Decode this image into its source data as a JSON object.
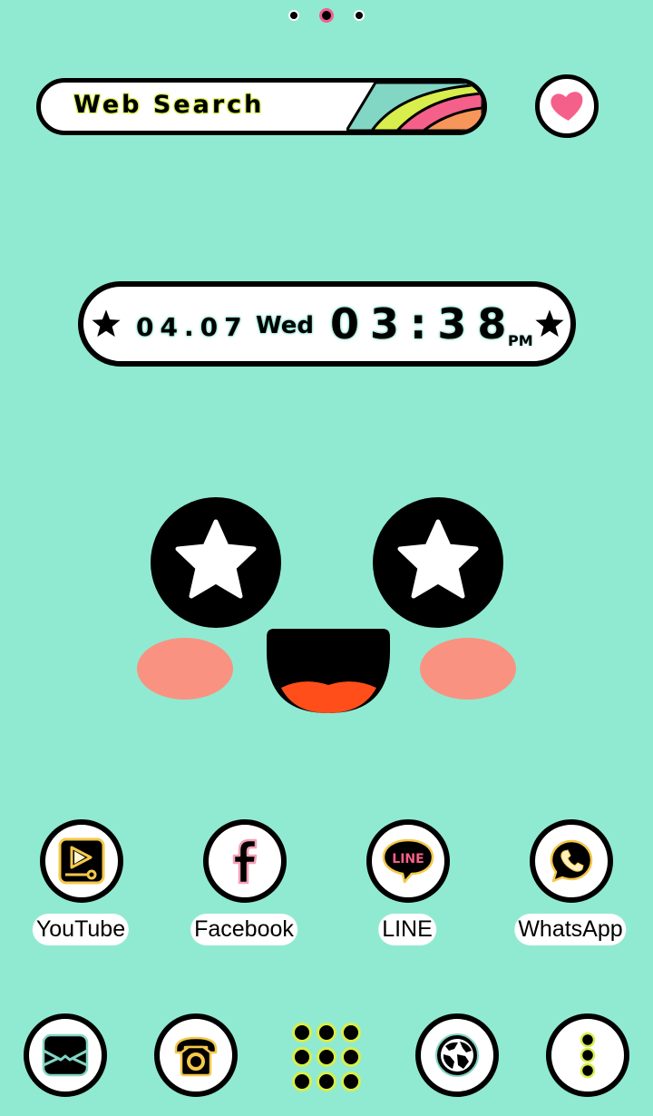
{
  "page_indicator": {
    "count": 3,
    "active_index": 1
  },
  "search_bar": {
    "label": "Web Search"
  },
  "favorites": {
    "icon": "heart-icon"
  },
  "clock": {
    "date": "04.07",
    "weekday": "Wed",
    "time": "03:38",
    "ampm": "PM"
  },
  "wallpaper": {
    "description": "kawaii face with star eyes, blush cheeks and open smile"
  },
  "apps": [
    {
      "label": "YouTube",
      "icon": "youtube-icon"
    },
    {
      "label": "Facebook",
      "icon": "facebook-icon"
    },
    {
      "label": "LINE",
      "icon": "line-icon",
      "icon_text": "LINE"
    },
    {
      "label": "WhatsApp",
      "icon": "whatsapp-icon"
    }
  ],
  "dock": [
    {
      "name": "email",
      "icon": "envelope-icon"
    },
    {
      "name": "phone",
      "icon": "phone-icon"
    },
    {
      "name": "app-drawer",
      "icon": "grid-icon"
    },
    {
      "name": "browser",
      "icon": "globe-icon"
    },
    {
      "name": "menu",
      "icon": "more-vertical-icon"
    }
  ],
  "colors": {
    "background": "#90ead1",
    "accent_yellow": "#d8ee4c",
    "accent_pink": "#f5608a",
    "accent_teal": "#82d6c4",
    "accent_orange": "#f7965a",
    "blush": "#fa9282",
    "tongue": "#ff4e1a",
    "gold": "#f5c84a"
  }
}
